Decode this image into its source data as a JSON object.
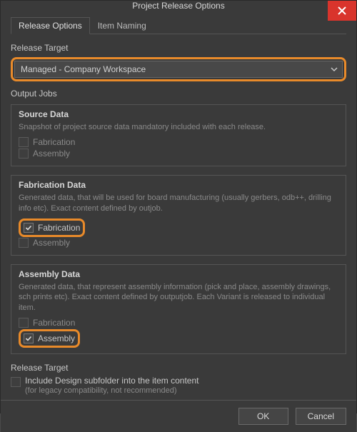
{
  "title": "Project Release Options",
  "tabs": {
    "release_options": "Release Options",
    "item_naming": "Item Naming"
  },
  "release_target": {
    "label": "Release Target",
    "value": "Managed - Company Workspace"
  },
  "output_jobs": {
    "label": "Output Jobs",
    "source_data": {
      "title": "Source Data",
      "desc": "Snapshot of project source data mandatory included with each release.",
      "fabrication": {
        "label": "Fabrication",
        "checked": false
      },
      "assembly": {
        "label": "Assembly",
        "checked": false
      }
    },
    "fabrication_data": {
      "title": "Fabrication Data",
      "desc": "Generated data, that will be used for board manufacturing (usually gerbers, odb++, drilling info etc). Exact content defined by outjob.",
      "fabrication": {
        "label": "Fabrication",
        "checked": true
      },
      "assembly": {
        "label": "Assembly",
        "checked": false
      }
    },
    "assembly_data": {
      "title": "Assembly Data",
      "desc": "Generated data, that represent assembly information (pick and place, assembly drawings, sch prints etc). Exact content defined by outputjob. Each Variant is released to individual item.",
      "fabrication": {
        "label": "Fabrication",
        "checked": false
      },
      "assembly": {
        "label": "Assembly",
        "checked": true
      }
    }
  },
  "release_target_footer": {
    "label": "Release Target",
    "include_label": "Include Design subfolder into the item content",
    "include_note": "(for legacy compatibility, not recommended)",
    "include_checked": false
  },
  "buttons": {
    "ok": "OK",
    "cancel": "Cancel"
  }
}
